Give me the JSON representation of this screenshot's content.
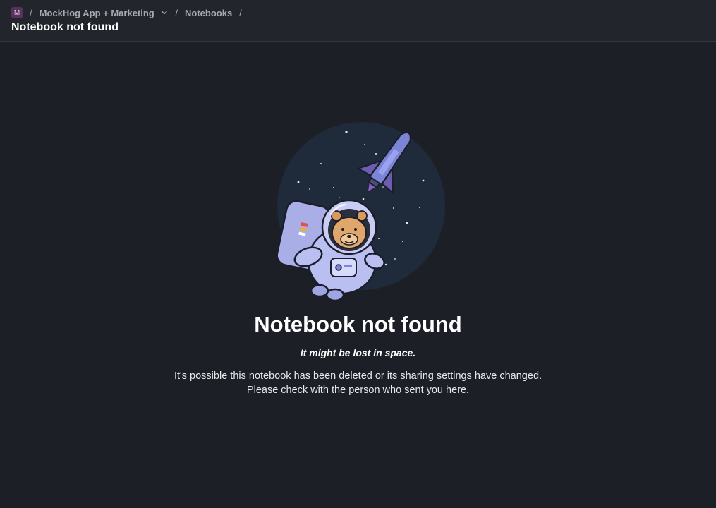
{
  "breadcrumbs": {
    "project_initial": "M",
    "separator": "/",
    "project_name": "MockHog App + Marketing",
    "section": "Notebooks"
  },
  "page": {
    "title": "Notebook not found"
  },
  "not_found": {
    "heading": "Notebook not found",
    "subheading": "It might be lost in space.",
    "line1": "It's possible this notebook has been deleted or its sharing settings have changed.",
    "line2": "Please check with the person who sent you here."
  },
  "colors": {
    "background": "#1d1f27",
    "topbar": "#23252d",
    "project_avatar": "#57325a",
    "illustration_circle": "#1f2a3a",
    "suit": "#b9bff0"
  },
  "icons": {
    "project_menu": "chevron-down-icon",
    "illustration": "astronaut-hedgehog-rocket-illustration"
  }
}
